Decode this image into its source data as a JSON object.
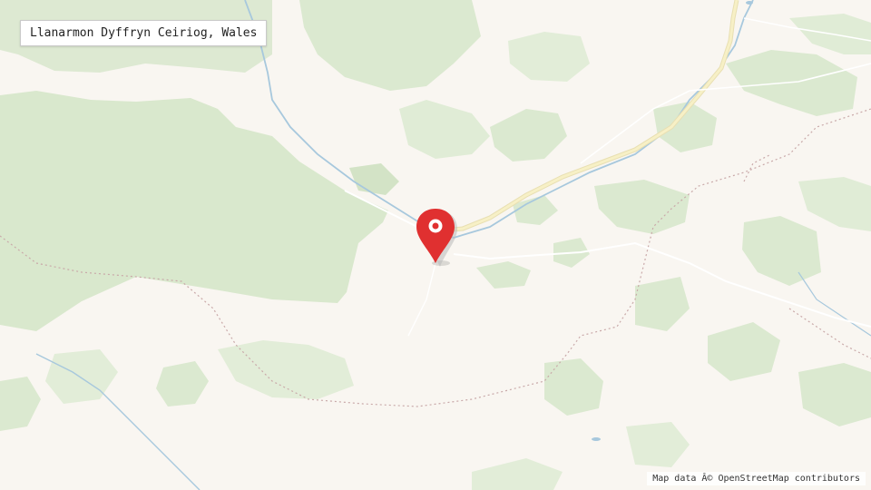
{
  "place": {
    "name": "Llanarmon Dyffryn Ceiriog, Wales"
  },
  "attribution": "Map data Â© OpenStreetMap contributors",
  "colors": {
    "land": "#f9f6f1",
    "forest": "#dbe9d0",
    "forest_dark": "#d3e3c6",
    "river": "#a7c8dd",
    "road_major": "#f7f0c6",
    "road_casing": "#e8dfb2",
    "road_minor": "#ffffff",
    "boundary": "#c9a9a9",
    "marker": "#e03030"
  },
  "icons": {
    "marker": "map-pin-icon"
  }
}
